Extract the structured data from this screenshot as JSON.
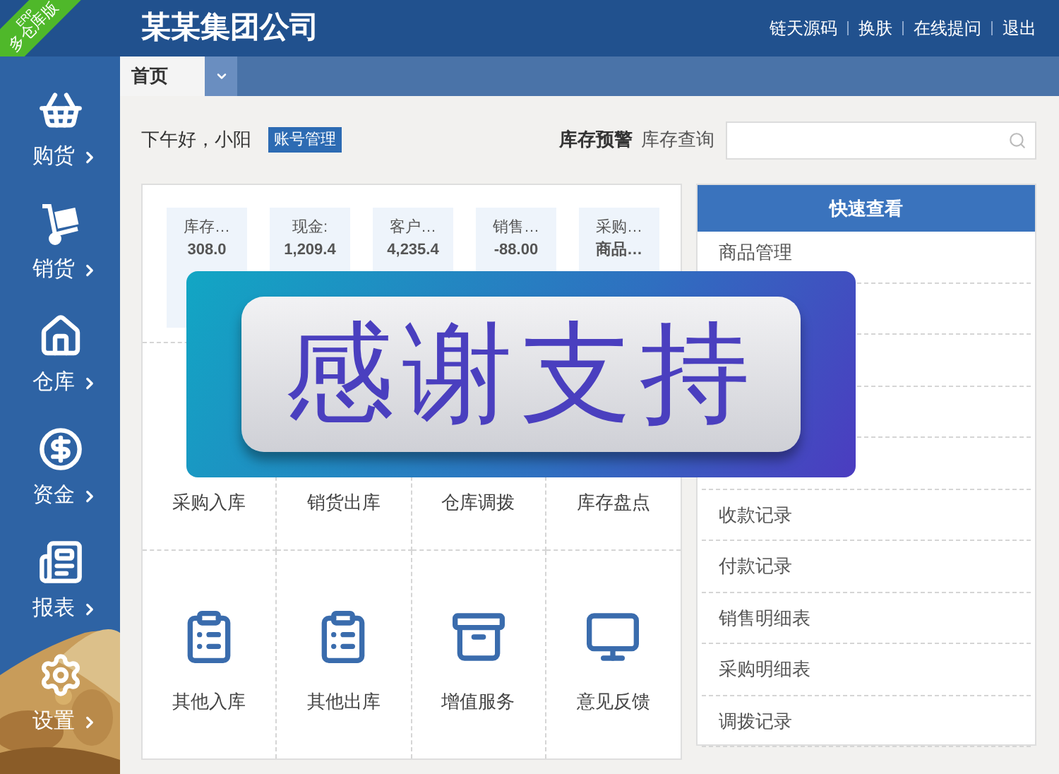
{
  "ribbon": {
    "line_1": "ERP",
    "line_2": "多仓库版"
  },
  "header": {
    "title": "某某集团公司",
    "links": [
      "链天源码",
      "换肤",
      "在线提问",
      "退出"
    ]
  },
  "sidebar": {
    "items": [
      {
        "kind": "basket",
        "label": "购货"
      },
      {
        "kind": "cart",
        "label": "销货"
      },
      {
        "kind": "house",
        "label": "仓库"
      },
      {
        "kind": "dollar",
        "label": "资金"
      },
      {
        "kind": "report",
        "label": "报表"
      },
      {
        "kind": "gear",
        "label": "设置"
      }
    ]
  },
  "tabs": [
    {
      "label": "首页",
      "selected": true
    }
  ],
  "greeting": "下午好，小阳",
  "account_button": "账号管理",
  "stock": {
    "warning": "库存预警",
    "query": "库存查询"
  },
  "stats": [
    {
      "lines": [
        "库存…",
        "308.0"
      ]
    },
    {
      "lines": [
        "现金:",
        "1,209.4"
      ]
    },
    {
      "lines": [
        "客户…",
        "4,235.4"
      ]
    },
    {
      "lines": [
        "销售…",
        "-88.00"
      ]
    },
    {
      "lines": [
        "采购…",
        "商品…"
      ]
    }
  ],
  "shortcuts": [
    {
      "label": "采购入库"
    },
    {
      "label": "销货出库"
    },
    {
      "label": "仓库调拨"
    },
    {
      "label": "库存盘点"
    },
    {
      "kind": "clipboard-in",
      "label": "其他入库"
    },
    {
      "kind": "clipboard-out",
      "label": "其他出库"
    },
    {
      "kind": "cabinet",
      "label": "增值服务"
    },
    {
      "kind": "monitor",
      "label": "意见反馈"
    }
  ],
  "quick_view": {
    "title": "快速查看",
    "items": [
      {
        "label": "商品管理"
      },
      {
        "label": "收款记录"
      },
      {
        "label": "付款记录"
      },
      {
        "label": "销售明细表"
      },
      {
        "label": "采购明细表"
      },
      {
        "label": "调拨记录"
      }
    ]
  },
  "overlay": {
    "text": "感谢支持"
  }
}
